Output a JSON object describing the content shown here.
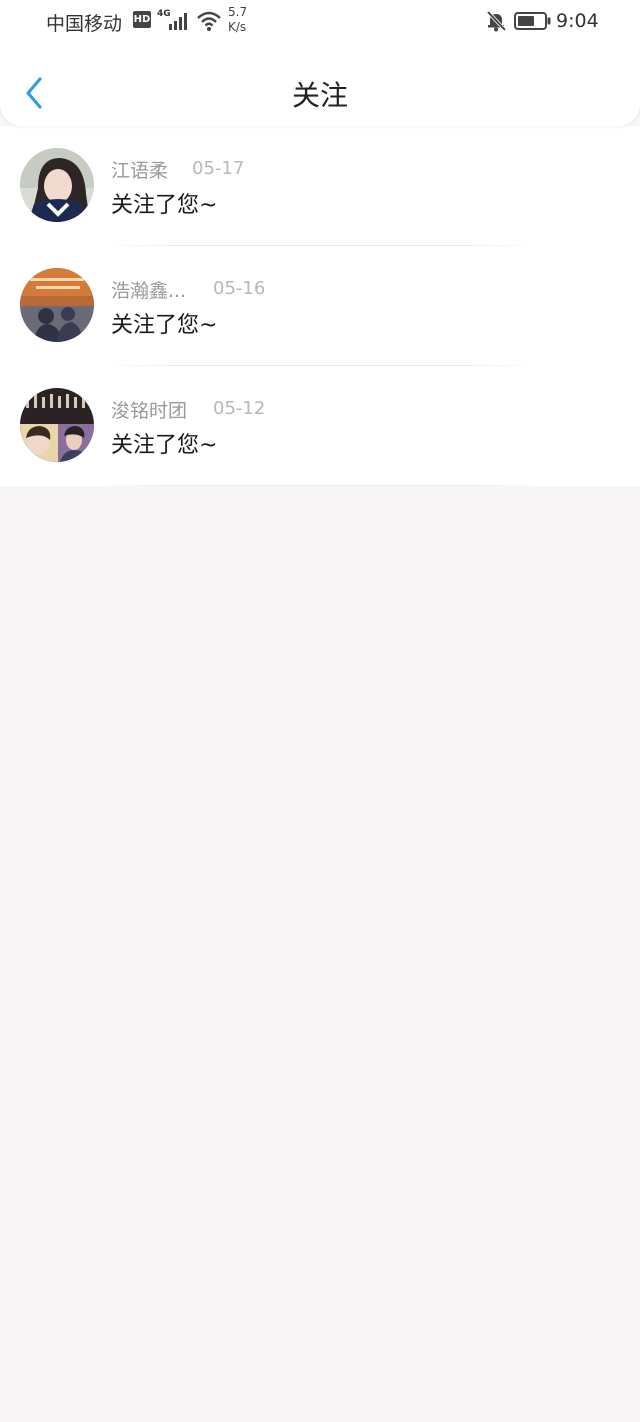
{
  "status_bar": {
    "carrier": "中国移动",
    "hd_badge": "HD",
    "network": "4G",
    "speed_value": "5.7",
    "speed_unit": "K/s",
    "time": "9:04"
  },
  "nav": {
    "title": "关注",
    "back_icon": "chevron-left-icon"
  },
  "colors": {
    "accent": "#2f9fe0",
    "background": "#f8f6f7",
    "name_text": "#9a9a9a",
    "date_text": "#b8b8b8"
  },
  "notifications": [
    {
      "name": "江语柔",
      "date": "05-17",
      "message": "关注了您~"
    },
    {
      "name": "浩瀚鑫...",
      "date": "05-16",
      "message": "关注了您~"
    },
    {
      "name": "浚铭时团",
      "date": "05-12",
      "message": "关注了您~"
    }
  ]
}
